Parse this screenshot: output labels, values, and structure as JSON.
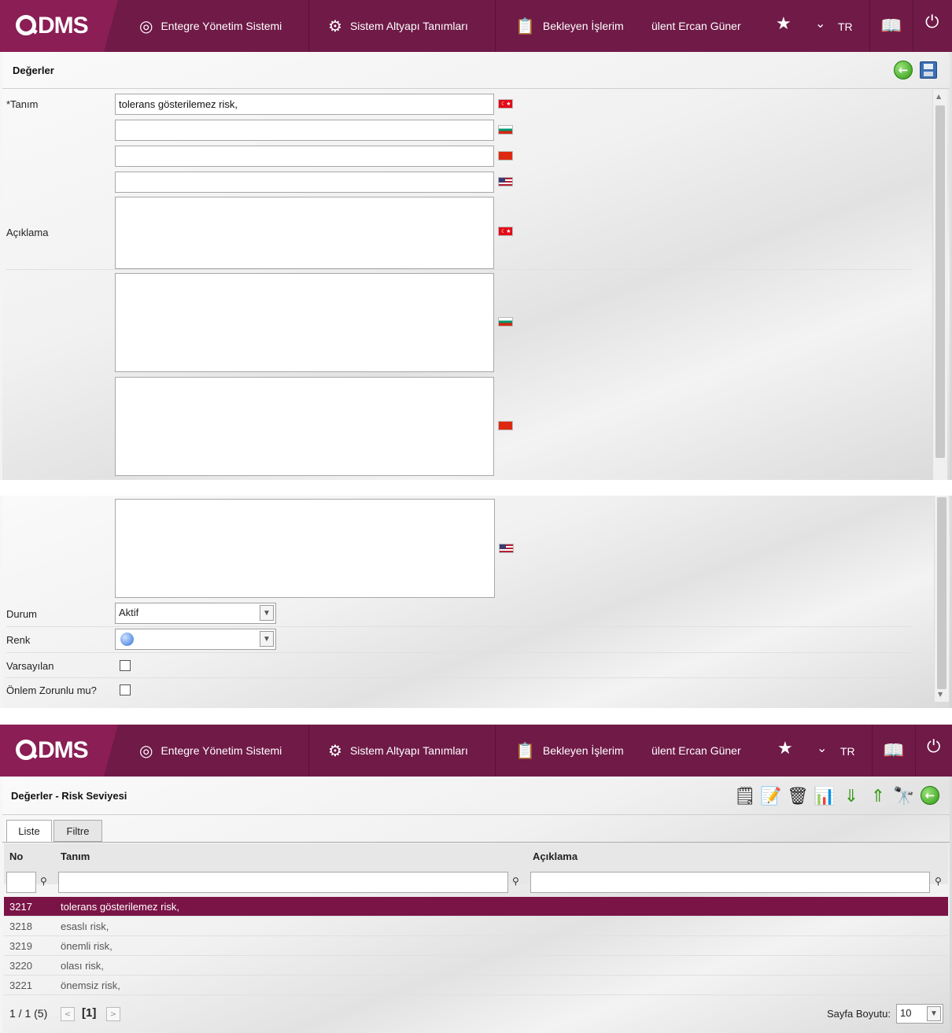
{
  "topbar": {
    "logo": "DMS",
    "nav": [
      {
        "label": "Entegre Yönetim Sistemi",
        "icon": "q-logo-icon"
      },
      {
        "label": "Sistem Altyapı Tanımları",
        "icon": "gear-icon"
      },
      {
        "label": "Bekleyen İşlerim",
        "icon": "clipboard-icon"
      }
    ],
    "user": "ülent Ercan Güner",
    "lang": "TR"
  },
  "form": {
    "title": "Değerler",
    "tanim_label": "*Tanım",
    "tanim_values": [
      "tolerans gösterilemez risk,",
      "",
      "",
      ""
    ],
    "aciklama_label": "Açıklama",
    "durum_label": "Durum",
    "durum_value": "Aktif",
    "renk_label": "Renk",
    "varsayilan_label": "Varsayılan",
    "onlem_label": "Önlem Zorunlu mu?",
    "colors": {
      "accent": "#6f1a47",
      "selected_row": "#7a1446"
    }
  },
  "list": {
    "title": "Değerler - Risk Seviyesi",
    "tabs": [
      "Liste",
      "Filtre"
    ],
    "columns": [
      "No",
      "Tanım",
      "Açıklama"
    ],
    "rows": [
      {
        "no": "3217",
        "tanim": "tolerans gösterilemez risk,",
        "aciklama": ""
      },
      {
        "no": "3218",
        "tanim": "esaslı risk,",
        "aciklama": ""
      },
      {
        "no": "3219",
        "tanim": "önemli risk,",
        "aciklama": ""
      },
      {
        "no": "3220",
        "tanim": "olası risk,",
        "aciklama": ""
      },
      {
        "no": "3221",
        "tanim": "önemsiz risk,",
        "aciklama": ""
      }
    ],
    "pager": {
      "info": "1 / 1 (5)",
      "current": "[1]",
      "page_size_label": "Sayfa Boyutu:",
      "page_size": "10"
    }
  }
}
